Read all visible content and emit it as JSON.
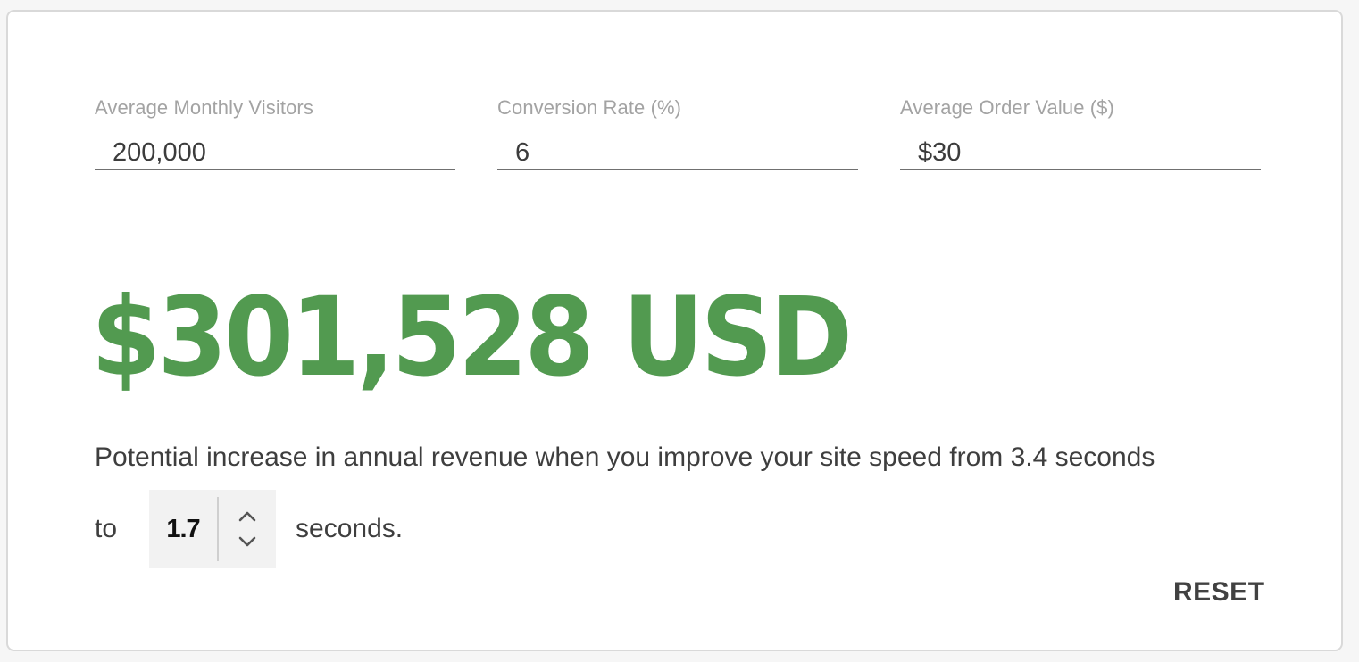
{
  "calculator": {
    "fields": [
      {
        "label": "Average Monthly Visitors",
        "value": "200,000"
      },
      {
        "label": "Conversion Rate (%)",
        "value": "6"
      },
      {
        "label": "Average Order Value ($)",
        "value": "$30"
      }
    ],
    "result": {
      "amount": "$301,528 USD",
      "color": "#529a50"
    },
    "description": {
      "text": "Potential increase in annual revenue when you improve your site speed from 3.4 seconds",
      "to_label": "to",
      "target_seconds": "1.7",
      "suffix": "seconds."
    },
    "stepper": {
      "up_icon": "chevron-up-icon",
      "down_icon": "chevron-down-icon"
    },
    "reset_label": "RESET"
  }
}
